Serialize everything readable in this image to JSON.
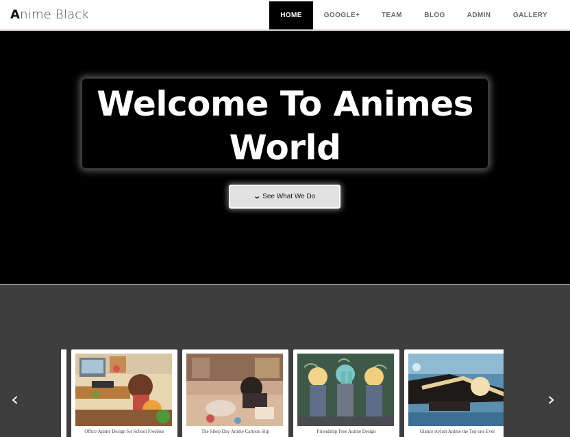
{
  "brand": {
    "initial": "A",
    "rest": "nime Black"
  },
  "nav": {
    "items": [
      {
        "label": "HOME",
        "active": true
      },
      {
        "label": "GOOGLE+",
        "active": false
      },
      {
        "label": "TEAM",
        "active": false
      },
      {
        "label": "BLOG",
        "active": false
      },
      {
        "label": "ADMIN",
        "active": false
      },
      {
        "label": "GALLERY",
        "active": false
      }
    ]
  },
  "hero": {
    "title_line1": "Welcome To Animes",
    "title_line2": "World",
    "cta_icon": "chevron-down-icon",
    "cta_label": "See What We Do"
  },
  "gallery": {
    "prev_icon": "chevron-left-icon",
    "next_icon": "chevron-right-icon",
    "cards": [
      {
        "caption": "Office Anime Design for School Freebies"
      },
      {
        "caption": "The Sleep Day Anime Cartoon Slip"
      },
      {
        "caption": "Friendship Free Anime Design"
      },
      {
        "caption": "Glance stylish Anime the Top one Ever"
      }
    ]
  },
  "colors": {
    "nav_active_bg": "#000000",
    "hero_bg": "#000000",
    "gallery_bg": "#3e3e3e"
  }
}
